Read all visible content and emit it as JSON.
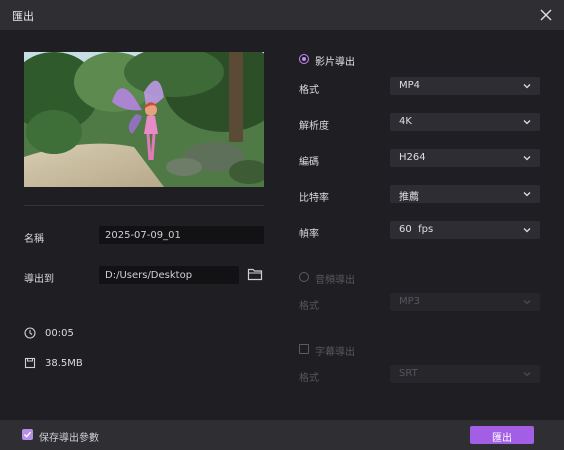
{
  "window": {
    "title": "匯出"
  },
  "details": {
    "name_label": "名稱",
    "name_value": "2025-07-09_01",
    "export_to_label": "導出到",
    "path_value": "D:/Users/Desktop",
    "duration": "00:05",
    "size": "38.5MB"
  },
  "video_export": {
    "label": "影片導出",
    "format_label": "格式",
    "format_value": "MP4",
    "resolution_label": "解析度",
    "resolution_value": "4K",
    "codec_label": "編碼",
    "codec_value": "H264",
    "bitrate_label": "比特率",
    "bitrate_value": "推薦",
    "framerate_label": "幀率",
    "framerate_value": "60  fps"
  },
  "audio_export": {
    "label": "音頻導出",
    "format_label": "格式",
    "format_value": "MP3"
  },
  "subtitle_export": {
    "label": "字幕導出",
    "format_label": "格式",
    "format_value": "SRT"
  },
  "footer": {
    "save_params_label": "保存導出參數",
    "export_button": "匯出"
  },
  "colors": {
    "accent": "#a35ee6",
    "accent_light": "#c08cf0"
  }
}
